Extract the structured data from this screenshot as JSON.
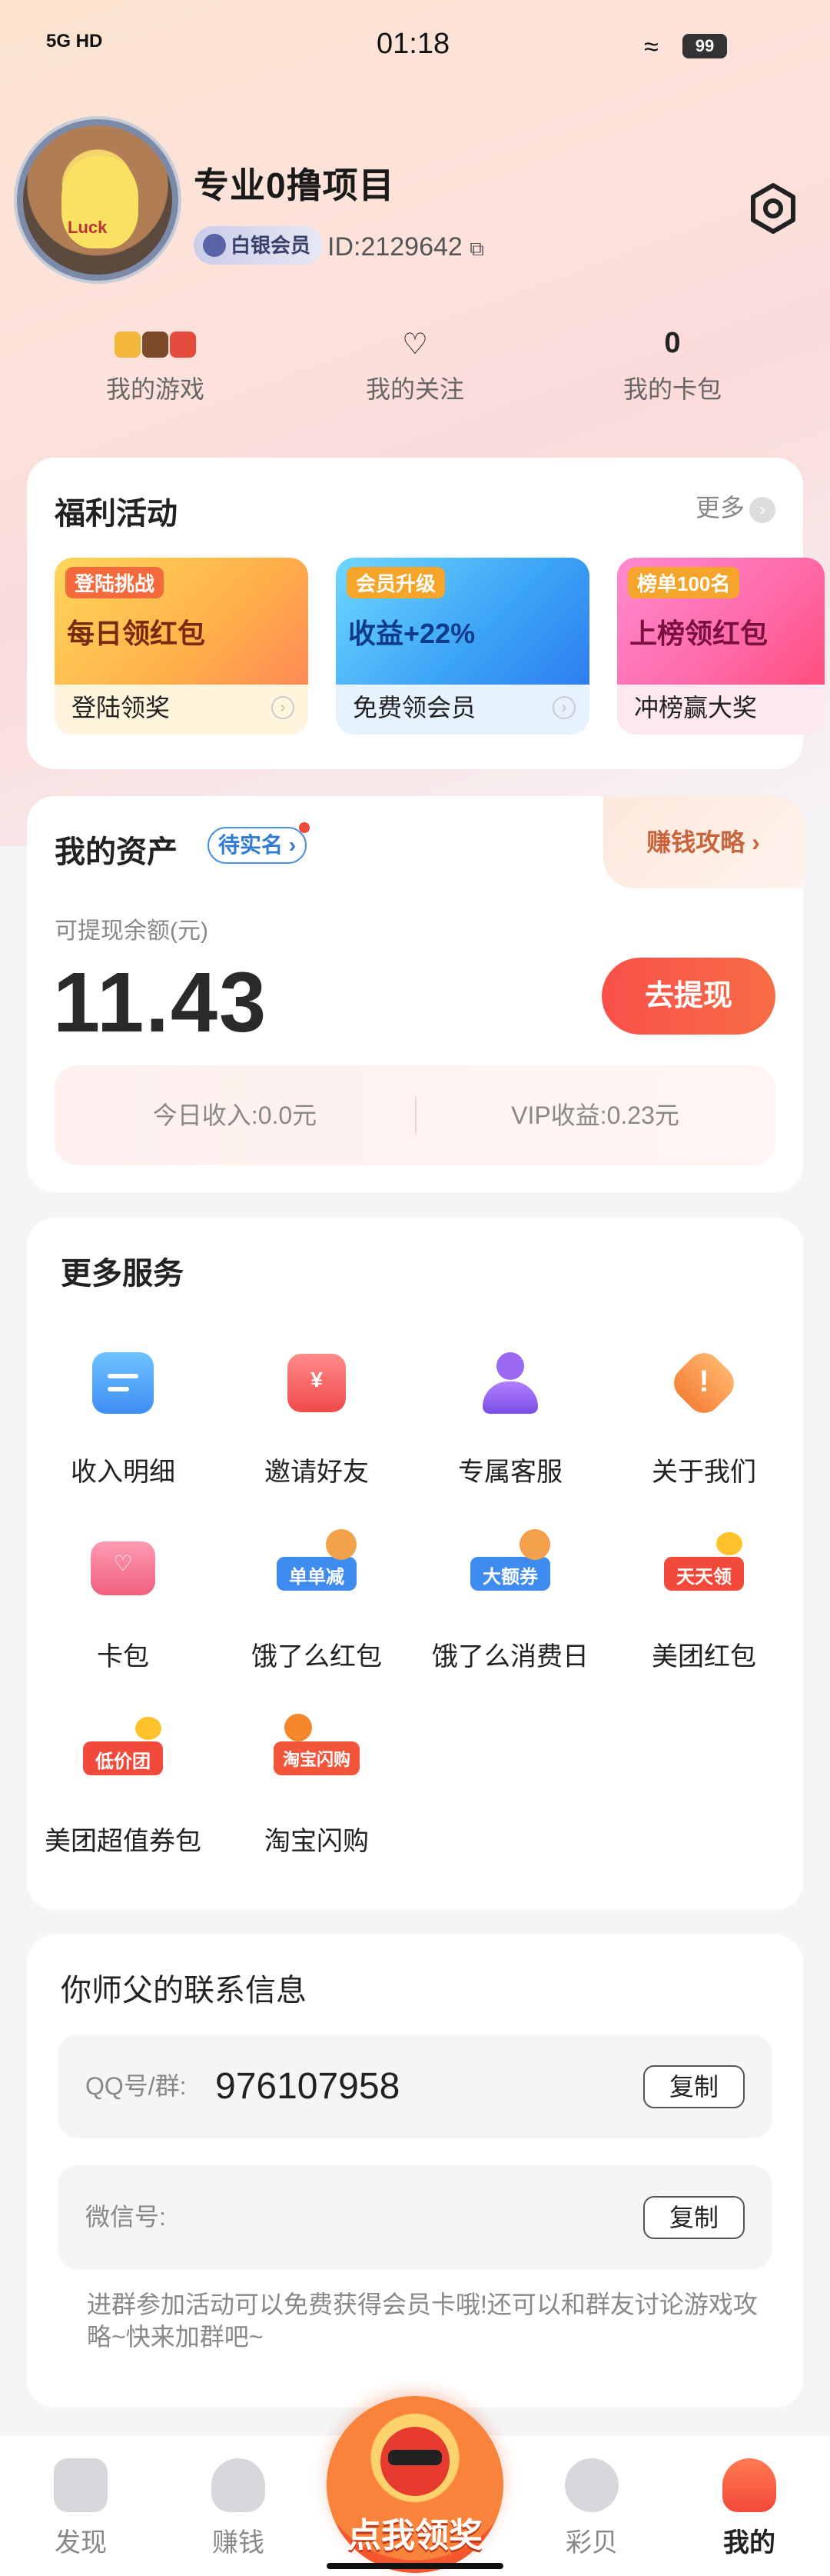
{
  "status_bar": {
    "time": "01:18",
    "network": "5G HD",
    "battery": "99"
  },
  "profile": {
    "username": "专业0撸项目",
    "member_badge": "白银会员",
    "user_id": "ID:2129642"
  },
  "stats": [
    {
      "value": "",
      "label": "我的游戏"
    },
    {
      "value": "",
      "label": "我的关注"
    },
    {
      "value": "0",
      "label": "我的卡包"
    }
  ],
  "welfare": {
    "title": "福利活动",
    "more": "更多",
    "promos": [
      {
        "tag": "登陆挑战",
        "headline": "每日领红包",
        "label": "登陆领奖"
      },
      {
        "tag": "会员升级",
        "headline": "收益+22%",
        "label": "免费领会员"
      },
      {
        "tag": "榜单100名",
        "headline": "上榜领红包",
        "label": "冲榜赢大奖"
      }
    ]
  },
  "assets": {
    "title": "我的资产",
    "realname_tag": "待实名",
    "strategy_tab": "赚钱攻略",
    "balance_label": "可提现余额(元)",
    "balance": "11.43",
    "withdraw_button": "去提现",
    "today_income": "今日收入:0.0元",
    "vip_income": "VIP收益:0.23元"
  },
  "services": {
    "title": "更多服务",
    "items": [
      {
        "label": "收入明细",
        "icon": "list-icon"
      },
      {
        "label": "邀请好友",
        "icon": "red-envelope-icon"
      },
      {
        "label": "专属客服",
        "icon": "customer-service-icon"
      },
      {
        "label": "关于我们",
        "icon": "info-icon"
      },
      {
        "label": "卡包",
        "icon": "card-wallet-icon"
      },
      {
        "label": "饿了么红包",
        "icon": "eleme-coupon-icon",
        "badge": "单单减"
      },
      {
        "label": "饿了么消费日",
        "icon": "eleme-day-icon",
        "badge": "大额券"
      },
      {
        "label": "美团红包",
        "icon": "meituan-coupon-icon",
        "badge": "天天领"
      },
      {
        "label": "美团超值券包",
        "icon": "meituan-pack-icon",
        "badge": "低价团"
      },
      {
        "label": "淘宝闪购",
        "icon": "taobao-flash-icon",
        "badge": "淘宝闪购"
      }
    ]
  },
  "master": {
    "title": "你师父的联系信息",
    "qq_label": "QQ号/群:",
    "qq_value": "976107958",
    "wechat_label": "微信号:",
    "wechat_value": "",
    "copy_label": "复制",
    "note": "进群参加活动可以免费获得会员卡哦!还可以和群友讨论游戏攻略~快来加群吧~"
  },
  "nav": {
    "tabs": [
      "发现",
      "赚钱",
      "点我领奖",
      "彩贝",
      "我的"
    ],
    "active": "我的"
  },
  "colors": {
    "accent_red": "#f9504a",
    "realname_blue": "#2f7bd6",
    "strategy_orange": "#c8643c"
  }
}
